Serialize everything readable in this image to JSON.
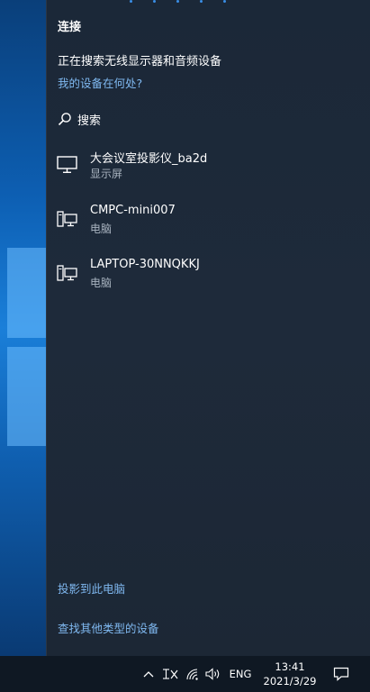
{
  "panel": {
    "title": "连接",
    "status": "正在搜索无线显示器和音频设备",
    "where_link": "我的设备在何处?",
    "search_label": "搜索",
    "devices": [
      {
        "name": "大会议室投影仪_ba2d",
        "type": "显示屏",
        "icon": "monitor-icon"
      },
      {
        "name": "CMPC-mini007",
        "type": "电脑",
        "icon": "computer-icon"
      },
      {
        "name": "LAPTOP-30NNQKKJ",
        "type": "电脑",
        "icon": "computer-icon"
      }
    ],
    "project_link": "投影到此电脑",
    "other_link": "查找其他类型的设备"
  },
  "taskbar": {
    "tray_icons": [
      "chevron-up-icon",
      "pen-workspace-icon",
      "wifi-icon",
      "volume-icon",
      "notification-icon"
    ],
    "language": "ENG",
    "time": "13:41",
    "date": "2021/3/29"
  },
  "colors": {
    "panel_bg": "#1e2a3a",
    "link": "#7fb8f0",
    "taskbar_bg": "#0f1823",
    "accent": "#3a8ee6"
  }
}
